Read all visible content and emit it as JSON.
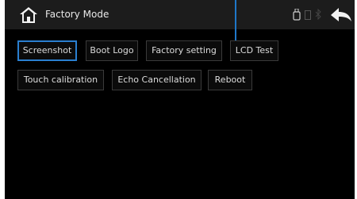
{
  "header": {
    "title": "Factory Mode"
  },
  "icons": {
    "home": "home-icon",
    "usb": "usb-icon",
    "sd_card": "sd-card-icon",
    "bluetooth": "bluetooth-icon",
    "back": "back-arrow-icon"
  },
  "colors": {
    "background": "#000000",
    "header_bar": "#1c1c1c",
    "selected_border": "#2a7fd0",
    "button_border": "#3a3a3a",
    "text": "#dcdcdc"
  },
  "buttons": {
    "screenshot": "Screenshot",
    "boot_logo": "Boot Logo",
    "factory_setting": "Factory setting",
    "lcd_test": "LCD Test",
    "touch_calibration": "Touch calibration",
    "echo_cancellation": "Echo Cancellation",
    "reboot": "Reboot"
  }
}
